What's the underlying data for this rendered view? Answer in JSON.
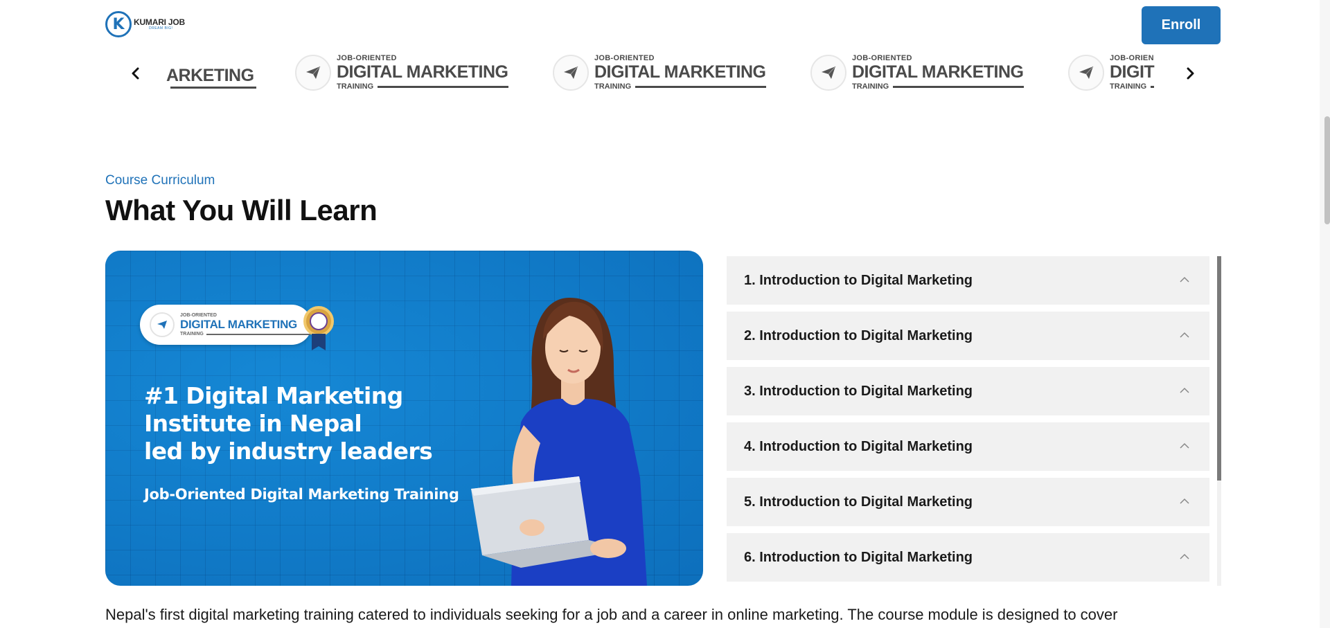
{
  "header": {
    "logo_name": "KUMARI JOB",
    "logo_tagline": "DREAM BIG!",
    "logo_letter": "K",
    "enroll_label": "Enroll"
  },
  "carousel": {
    "slides": [
      {
        "top": "",
        "main": "ARKETING",
        "bottom": ""
      },
      {
        "top": "JOB-ORIENTED",
        "main": "DIGITAL MARKETING",
        "bottom": "TRAINING"
      },
      {
        "top": "JOB-ORIENTED",
        "main": "DIGITAL MARKETING",
        "bottom": "TRAINING"
      },
      {
        "top": "JOB-ORIENTED",
        "main": "DIGITAL MARKETING",
        "bottom": "TRAINING"
      },
      {
        "top": "JOB-ORIEN",
        "main": "DIGIT",
        "bottom": "TRAINING"
      }
    ]
  },
  "section": {
    "kicker": "Course Curriculum",
    "heading": "What You Will Learn"
  },
  "banner": {
    "badge_top": "JOB-ORIENTED",
    "badge_main": "DIGITAL MARKETING",
    "badge_bottom": "TRAINING",
    "title_line1": "#1 Digital Marketing",
    "title_line2": "Institute in Nepal",
    "title_line3": "led by industry leaders",
    "subtitle": "Job-Oriented Digital Marketing Training"
  },
  "curriculum": {
    "items": [
      "1. Introduction to Digital Marketing",
      "2. Introduction to Digital Marketing",
      "3. Introduction to Digital Marketing",
      "4. Introduction to Digital Marketing",
      "5. Introduction to Digital Marketing",
      "6. Introduction to Digital Marketing"
    ]
  },
  "description": "Nepal's first digital marketing training catered to individuals seeking for a job and a career in online marketing. The course module is designed to cover",
  "colors": {
    "brand_blue": "#1f72b8",
    "banner_blue": "#1180cc",
    "accordion_bg": "#f1f1f1"
  },
  "icons": {
    "carousel_prev": "chevron-left-icon",
    "carousel_next": "chevron-right-icon",
    "accordion_toggle": "chevron-up-icon",
    "slide_logo": "paper-plane-icon"
  }
}
